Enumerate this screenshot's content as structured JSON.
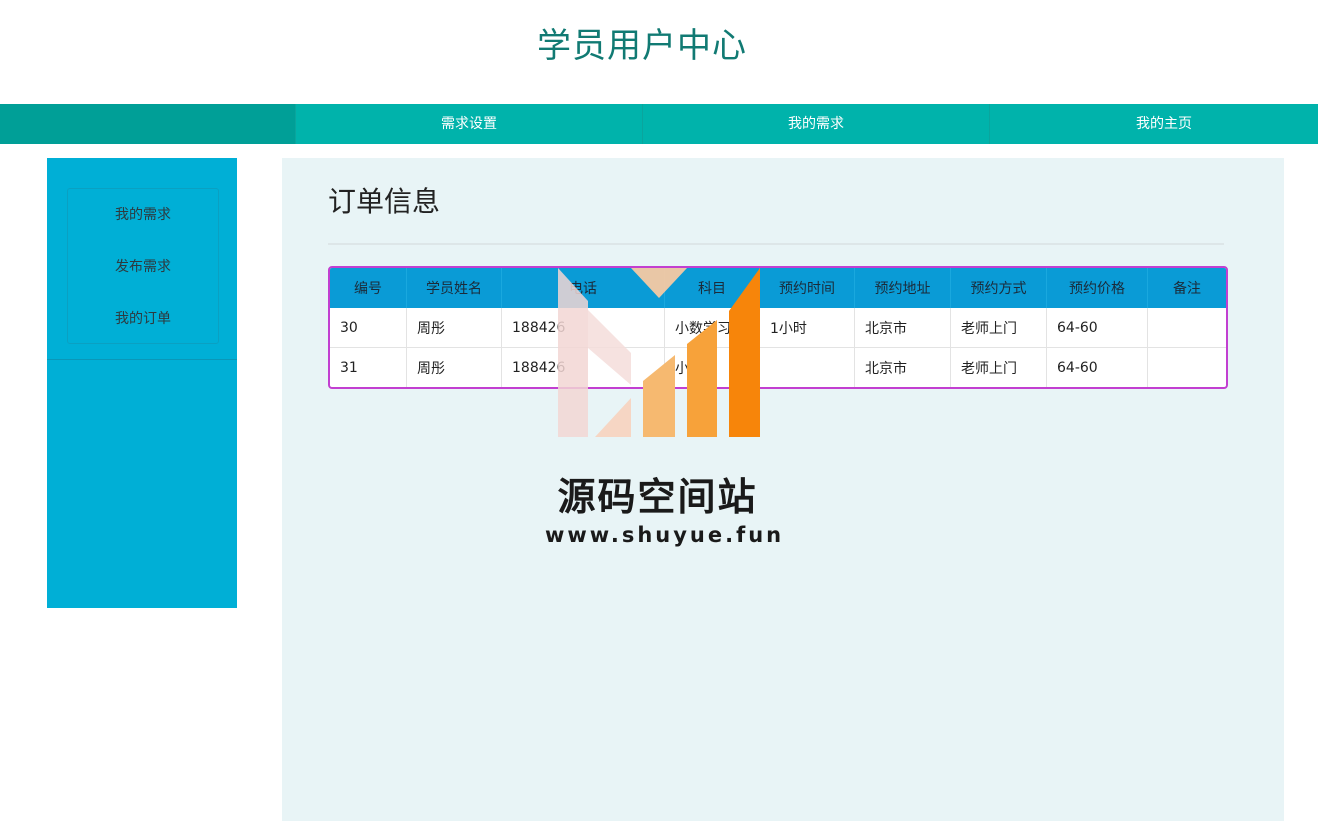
{
  "header": {
    "title": "学员用户中心"
  },
  "nav": {
    "items": [
      {
        "label": "需求设置"
      },
      {
        "label": "我的需求"
      },
      {
        "label": "我的主页"
      }
    ]
  },
  "sidebar": {
    "items": [
      {
        "label": "我的需求"
      },
      {
        "label": "发布需求"
      },
      {
        "label": "我的订单"
      }
    ]
  },
  "main": {
    "title": "订单信息",
    "table": {
      "columns": [
        "编号",
        "学员姓名",
        "电话",
        "科目",
        "预约时间",
        "预约地址",
        "预约方式",
        "预约价格",
        "备注"
      ],
      "rows": [
        [
          "30",
          "周彤",
          "188426",
          "小数学习",
          "1小时",
          "北京市",
          "老师上门",
          "64-60",
          ""
        ],
        [
          "31",
          "周彤",
          "188426",
          "小学",
          "",
          "北京市",
          "老师上门",
          "64-60",
          ""
        ]
      ]
    }
  },
  "watermark": {
    "title": "源码空间站",
    "url": "www.shuyue.fun"
  },
  "colors": {
    "header_text": "#117a73",
    "nav_bg": "#00b3ab",
    "sidebar_bg": "#00afd6",
    "table_header_bg": "#0a9bd6",
    "table_border": "#c23fd1",
    "content_bg": "#e8f4f6"
  }
}
